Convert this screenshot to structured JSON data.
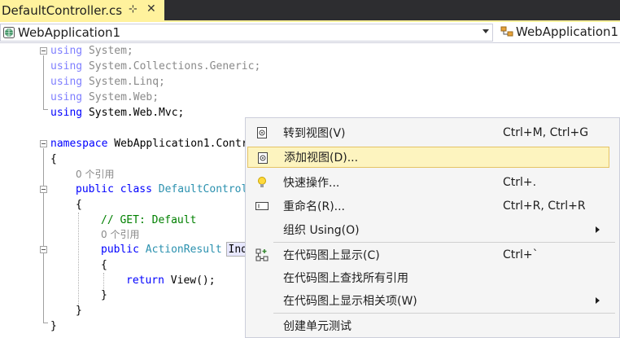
{
  "tab": {
    "filename": "DefaultController.cs",
    "pin_icon": "pin-icon",
    "close_icon": "close-icon",
    "active_color": "#fff29d"
  },
  "nav": {
    "project": "WebApplication1",
    "class": "WebApplication1"
  },
  "code": {
    "using_kw": "using",
    "usings": [
      "System;",
      "System.Collections.Generic;",
      "System.Linq;",
      "System.Web;",
      "System.Web.Mvc;"
    ],
    "namespace_kw": "namespace",
    "namespace_name": "WebApplication1.Contr",
    "brace_open": "{",
    "brace_close": "}",
    "ref_count": "0 个引用",
    "public_kw": "public",
    "class_kw": "class",
    "class_name": "DefaultControl",
    "comment": "// GET: Default",
    "method_return_type": "ActionResult",
    "method_name": "Ind",
    "return_kw": "return",
    "return_expr": "View();"
  },
  "menu": {
    "items": [
      {
        "label": "转到视图(V)",
        "shortcut": "Ctrl+M, Ctrl+G",
        "icon": "view-icon"
      },
      {
        "label": "添加视图(D)...",
        "shortcut": "",
        "icon": "add-view-icon"
      },
      {
        "label": "快速操作...",
        "shortcut": "Ctrl+.",
        "icon": "lightbulb-icon"
      },
      {
        "label": "重命名(R)...",
        "shortcut": "Ctrl+R, Ctrl+R",
        "icon": "rename-icon"
      },
      {
        "label": "组织 Using(O)",
        "shortcut": "",
        "icon": ""
      },
      {
        "label": "在代码图上显示(C)",
        "shortcut": "Ctrl+`",
        "icon": "code-map-icon"
      },
      {
        "label": "在代码图上查找所有引用",
        "shortcut": "",
        "icon": ""
      },
      {
        "label": "在代码图上显示相关项(W)",
        "shortcut": "",
        "icon": ""
      },
      {
        "label": "创建单元测试",
        "shortcut": "",
        "icon": ""
      }
    ],
    "hover_color": "#fdf4bf"
  }
}
